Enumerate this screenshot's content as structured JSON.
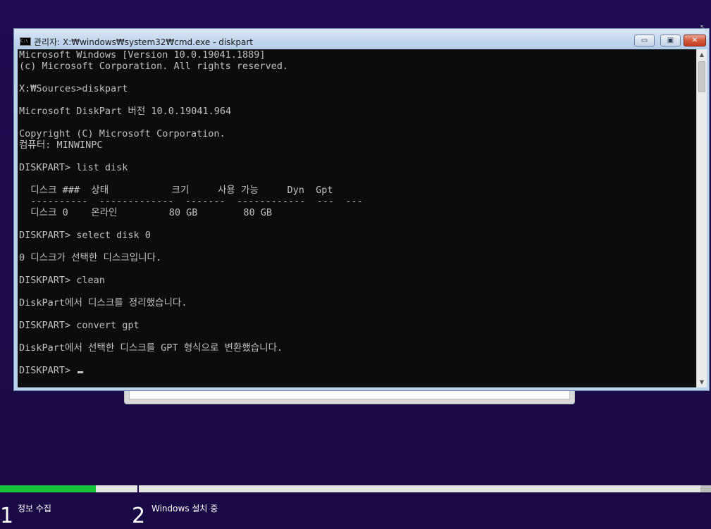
{
  "window": {
    "title": "관리자: X:₩windows₩system32₩cmd.exe - diskpart",
    "icon": "C:\\",
    "buttons": {
      "minimize": "▭",
      "maximize": "▣",
      "close": "✕"
    }
  },
  "console": {
    "lines": [
      "Microsoft Windows [Version 10.0.19041.1889]",
      "(c) Microsoft Corporation. All rights reserved.",
      "",
      "X:₩Sources>diskpart",
      "",
      "Microsoft DiskPart 버전 10.0.19041.964",
      "",
      "Copyright (C) Microsoft Corporation.",
      "컴퓨터: MINWINPC",
      "",
      "DISKPART> list disk",
      "",
      "  디스크 ###  상태           크기     사용 가능     Dyn  Gpt",
      "  ----------  -------------  -------  ------------  ---  ---",
      "  디스크 0    온라인         80 GB        80 GB",
      "",
      "DISKPART> select disk 0",
      "",
      "0 디스크가 선택한 디스크입니다.",
      "",
      "DISKPART> clean",
      "",
      "DiskPart에서 디스크를 정리했습니다.",
      "",
      "DISKPART> convert gpt",
      "",
      "DiskPart에서 선택한 디스크를 GPT 형식으로 변환했습니다.",
      "",
      "DISKPART> "
    ]
  },
  "setup": {
    "progress": 0.135,
    "steps": [
      {
        "number": "1",
        "label": "정보 수집"
      },
      {
        "number": "2",
        "label": "Windows 설치 중"
      }
    ]
  },
  "colors": {
    "desktop": "#1d0a4c",
    "console_bg": "#0c0c0c",
    "console_text": "#c0c0c0",
    "progress": "#19c33a"
  }
}
